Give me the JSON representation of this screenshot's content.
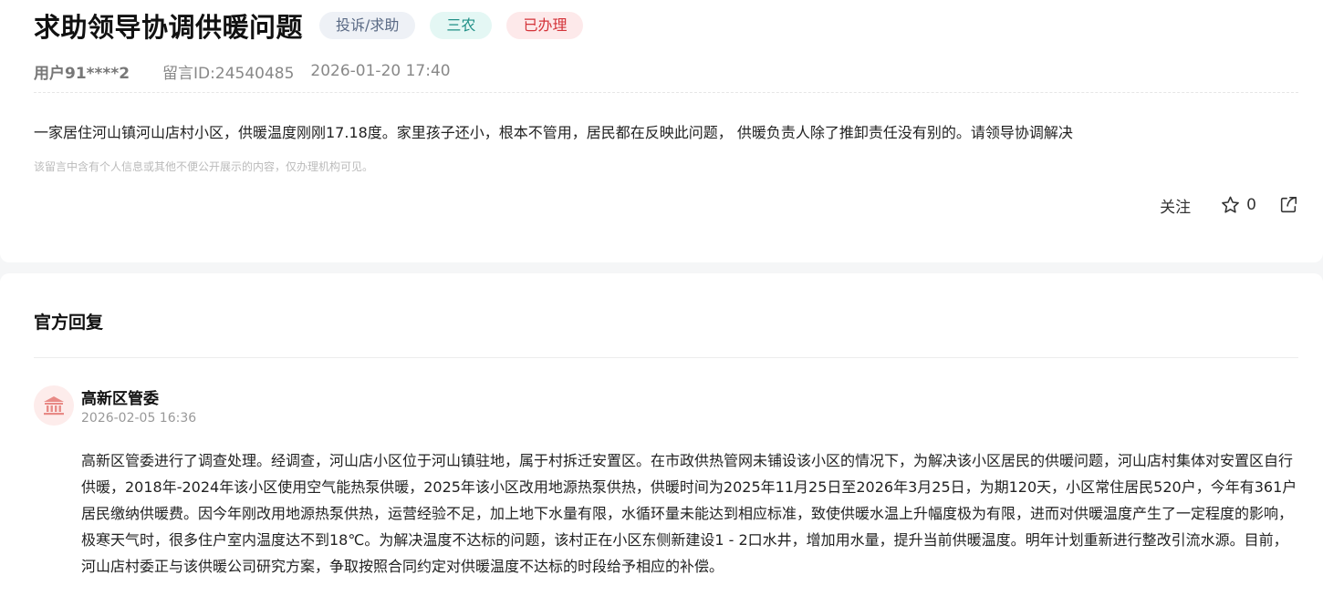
{
  "message": {
    "title": "求助领导协调供暖问题",
    "tags": {
      "category": "投诉/求助",
      "area": "三农",
      "status": "已办理"
    },
    "user": "用户91****2",
    "message_id": "留言ID:24540485",
    "time": "2026-01-20 17:40",
    "content": "一家居住河山镇河山店村小区，供暖温度刚刚17.18度。家里孩子还小，根本不管用，居民都在反映此问题， 供暖负责人除了推卸责任没有别的。请领导协调解决",
    "privacy_notice": "该留言中含有个人信息或其他不便公开展示的内容，仅办理机构可见。",
    "actions": {
      "follow_label": "关注",
      "star_count": "0"
    }
  },
  "reply": {
    "section_title": "官方回复",
    "org_name": "高新区管委",
    "time": "2026-02-05 16:36",
    "text": "高新区管委进行了调查处理。经调查，河山店小区位于河山镇驻地，属于村拆迁安置区。在市政供热管网未铺设该小区的情况下，为解决该小区居民的供暖问题，河山店村集体对安置区自行供暖，2018年-2024年该小区使用空气能热泵供暖，2025年该小区改用地源热泵供热，供暖时间为2025年11月25日至2026年3月25日，为期120天，小区常住居民520户，今年有361户居民缴纳供暖费。因今年刚改用地源热泵供热，运营经验不足，加上地下水量有限，水循环量未能达到相应标准，致使供暖水温上升幅度极为有限，进而对供暖温度产生了一定程度的影响，极寒天气时，很多住户室内温度达不到18℃。为解决温度不达标的问题，该村正在小区东侧新建设1 - 2口水井，增加用水量，提升当前供暖温度。明年计划重新进行整改引流水源。目前，河山店村委正与该供暖公司研究方案，争取按照合同约定对供暖温度不达标的时段给予相应的补偿。"
  },
  "icons": {
    "star": "star-outline-icon",
    "share": "share-icon",
    "avatar": "government-building-icon"
  },
  "colors": {
    "tag_category_text": "#5a6a85",
    "tag_area_text": "#1f8f86",
    "tag_status_text": "#d4343a",
    "avatar_icon": "#e88a86"
  }
}
